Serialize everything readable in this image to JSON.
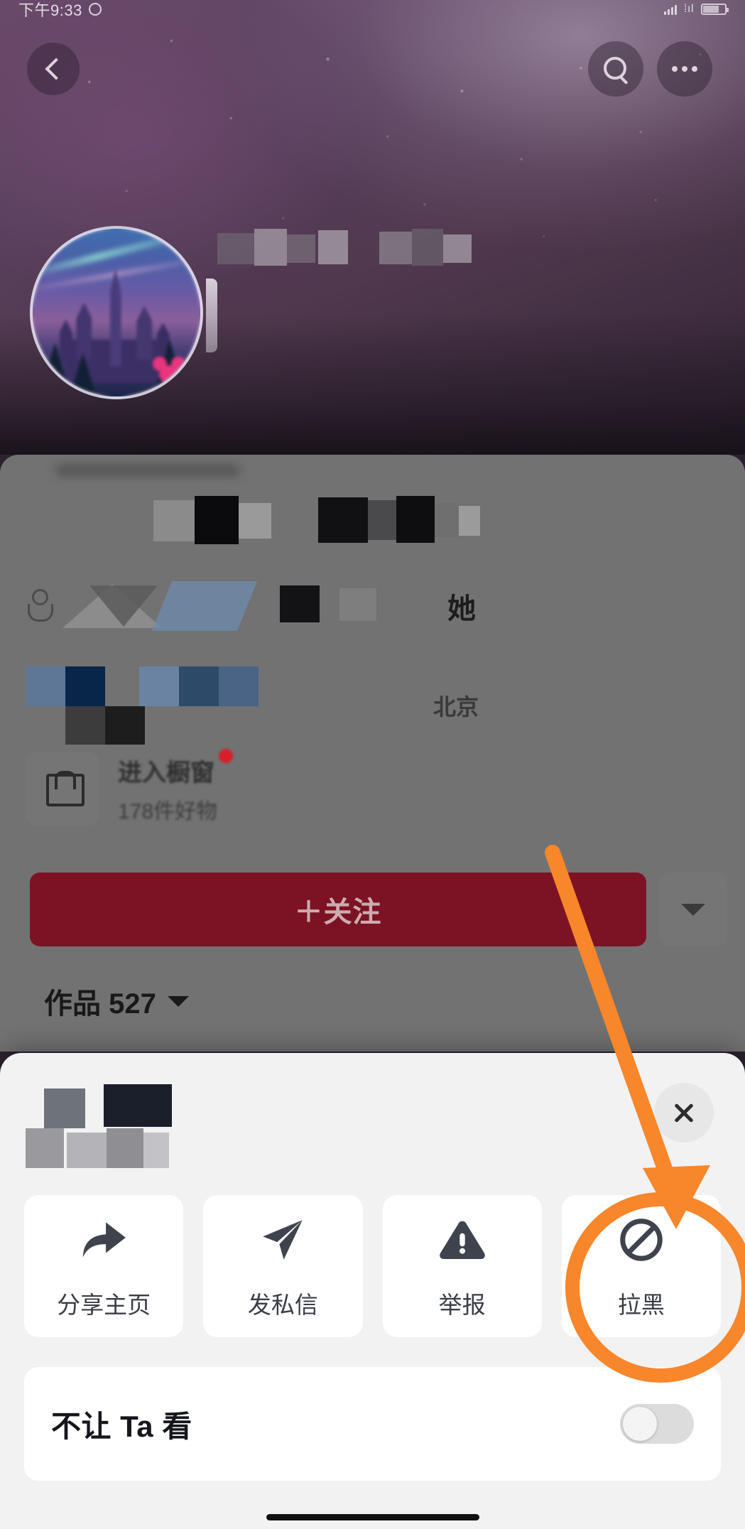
{
  "status_bar": {
    "time": "下午9:33",
    "clock_icon": "clock-icon",
    "signal_icon": "signal-bars-icon",
    "data_icon": "mobile-data-icon",
    "battery_icon": "battery-icon"
  },
  "header": {
    "back_icon": "chevron-left-icon",
    "search_icon": "search-icon",
    "more_icon": "more-dots-icon",
    "avatar_name": "avatar",
    "cover_name": "profile-cover-image"
  },
  "profile": {
    "gender_text": "她",
    "location_text": "北京",
    "shop": {
      "icon": "shopping-bag-icon",
      "title": "进入橱窗",
      "subtitle": "178件好物",
      "badge_name": "new-badge-dot"
    },
    "follow": {
      "label": "＋关注",
      "color": "#7c1324",
      "caret_icon": "chevron-down-icon"
    },
    "works": {
      "label": "作品 527",
      "caret_icon": "chevron-down-icon"
    }
  },
  "bottom_sheet": {
    "close_icon": "close-icon",
    "actions": [
      {
        "label": "分享主页",
        "icon": "share-arrow-icon"
      },
      {
        "label": "发私信",
        "icon": "paper-plane-icon"
      },
      {
        "label": "举报",
        "icon": "warning-triangle-icon"
      },
      {
        "label": "拉黑",
        "icon": "block-circle-icon"
      }
    ],
    "setting_row": {
      "label": "不让 Ta 看",
      "toggle_state": "off"
    }
  },
  "annotation": {
    "color": "#f8862b",
    "arrow_name": "highlight-arrow",
    "circle_name": "highlight-circle",
    "target_label": "拉黑"
  },
  "colors": {
    "accent_orange": "#f8862b",
    "follow_red": "#7c1324",
    "sheet_bg": "#f2f2f2",
    "card_bg": "#ffffff",
    "icon_dark": "#3f434d"
  }
}
